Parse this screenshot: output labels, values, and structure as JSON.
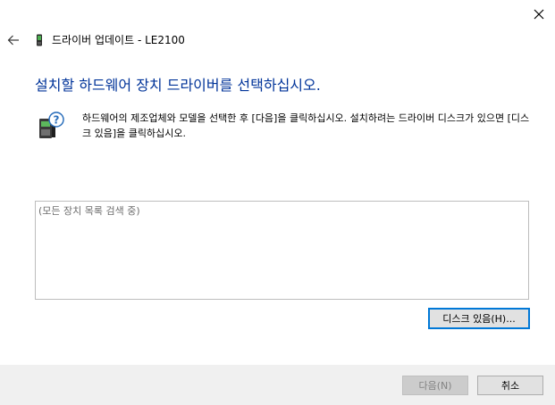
{
  "window": {
    "title": "드라이버 업데이트 - LE2100",
    "close_icon": "close-icon",
    "back_icon": "back-arrow-icon",
    "device_icon": "device-icon"
  },
  "main": {
    "heading": "설치할 하드웨어 장치 드라이버를 선택하십시오.",
    "hardware_icon": "hardware-question-icon",
    "instruction": "하드웨어의 제조업체와 모델을 선택한 후 [다음]을 클릭하십시오. 설치하려는 드라이버 디스크가 있으면 [디스크 있음]을 클릭하십시오.",
    "device_list": {
      "status_text": "(모든 장치 목록 검색 중)"
    },
    "have_disk_label": "디스크 있음(H)..."
  },
  "footer": {
    "next_label": "다음(N)",
    "cancel_label": "취소"
  },
  "colors": {
    "heading": "#003399",
    "accent_border": "#0078d7",
    "footer_bg": "#f0f0f0"
  }
}
